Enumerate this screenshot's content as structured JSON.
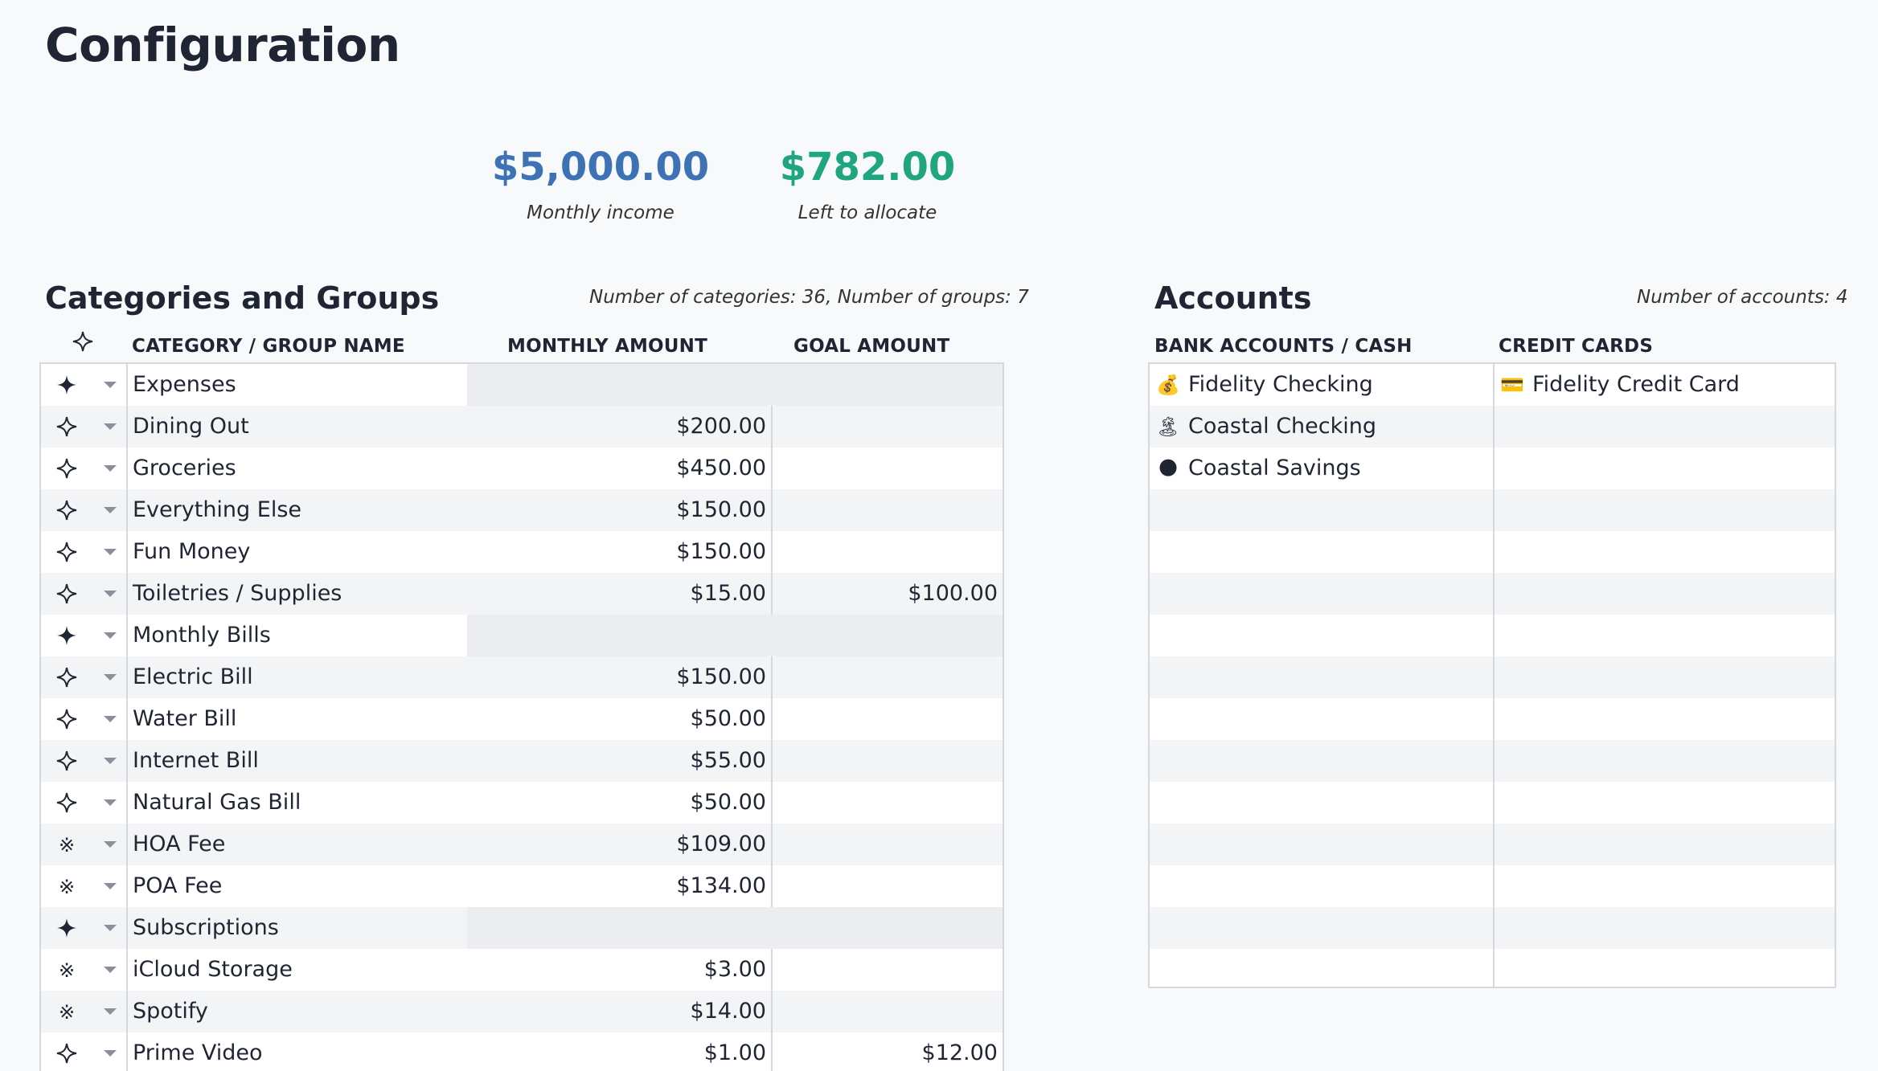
{
  "page": {
    "title": "Configuration"
  },
  "summary": {
    "income": {
      "amount": "$5,000.00",
      "caption": "Monthly income"
    },
    "left": {
      "amount": "$782.00",
      "caption": "Left to allocate"
    }
  },
  "categories": {
    "title": "Categories and Groups",
    "note": "Number of categories: 36, Number of groups: 7",
    "headers": {
      "name": "CATEGORY / GROUP NAME",
      "amount": "MONTHLY AMOUNT",
      "goal": "GOAL AMOUNT"
    },
    "rows": [
      {
        "icon": "filled-star-icon",
        "name": "Expenses",
        "amount": "",
        "goal": "",
        "group": true
      },
      {
        "icon": "outline-star-icon",
        "name": "Dining Out",
        "amount": "$200.00",
        "goal": ""
      },
      {
        "icon": "outline-star-icon",
        "name": "Groceries",
        "amount": "$450.00",
        "goal": ""
      },
      {
        "icon": "outline-star-icon",
        "name": "Everything Else",
        "amount": "$150.00",
        "goal": ""
      },
      {
        "icon": "outline-star-icon",
        "name": "Fun Money",
        "amount": "$150.00",
        "goal": ""
      },
      {
        "icon": "outline-star-icon",
        "name": "Toiletries / Supplies",
        "amount": "$15.00",
        "goal": "$100.00"
      },
      {
        "icon": "filled-star-icon",
        "name": "Monthly Bills",
        "amount": "",
        "goal": "",
        "group": true
      },
      {
        "icon": "outline-star-icon",
        "name": "Electric Bill",
        "amount": "$150.00",
        "goal": ""
      },
      {
        "icon": "outline-star-icon",
        "name": "Water Bill",
        "amount": "$50.00",
        "goal": ""
      },
      {
        "icon": "outline-star-icon",
        "name": "Internet Bill",
        "amount": "$55.00",
        "goal": ""
      },
      {
        "icon": "outline-star-icon",
        "name": "Natural Gas Bill",
        "amount": "$50.00",
        "goal": ""
      },
      {
        "icon": "asterisk-icon",
        "name": "HOA Fee",
        "amount": "$109.00",
        "goal": ""
      },
      {
        "icon": "asterisk-icon",
        "name": "POA Fee",
        "amount": "$134.00",
        "goal": ""
      },
      {
        "icon": "filled-star-icon",
        "name": "Subscriptions",
        "amount": "",
        "goal": "",
        "group": true
      },
      {
        "icon": "asterisk-icon",
        "name": "iCloud Storage",
        "amount": "$3.00",
        "goal": ""
      },
      {
        "icon": "asterisk-icon",
        "name": "Spotify",
        "amount": "$14.00",
        "goal": ""
      },
      {
        "icon": "outline-star-icon",
        "name": "Prime Video",
        "amount": "$1.00",
        "goal": "$12.00"
      }
    ]
  },
  "accounts": {
    "title": "Accounts",
    "note": "Number of accounts: 4",
    "headers": {
      "bank": "BANK ACCOUNTS / CASH",
      "credit": "CREDIT CARDS"
    },
    "bank": [
      {
        "emoji": "💰",
        "icon": "money-bag-icon",
        "name": "Fidelity Checking"
      },
      {
        "emoji": "🏝",
        "icon": "island-icon",
        "name": "Coastal Checking"
      },
      {
        "emoji": "🌑",
        "icon": "moon-icon",
        "name": "Coastal Savings"
      }
    ],
    "credit": [
      {
        "emoji": "💳",
        "icon": "credit-card-icon",
        "name": "Fidelity Credit Card"
      }
    ]
  },
  "colors": {
    "income": "#3d73b5",
    "left_to_allocate": "#1fa57f",
    "text": "#1f2533"
  }
}
